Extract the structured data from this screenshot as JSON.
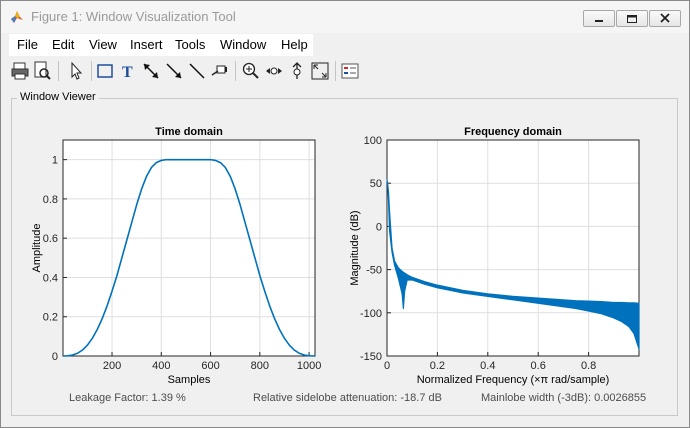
{
  "window": {
    "title": "Figure 1: Window Visualization Tool",
    "controls": [
      "minimize",
      "restore",
      "close"
    ]
  },
  "menu": {
    "items": [
      "File",
      "Edit",
      "View",
      "Insert",
      "Tools",
      "Window",
      "Help"
    ]
  },
  "toolbar": {
    "buttons": [
      {
        "name": "print-icon"
      },
      {
        "name": "print-preview-icon"
      },
      {
        "name": "pointer-icon"
      },
      {
        "name": "rectangle-icon"
      },
      {
        "name": "text-icon"
      },
      {
        "name": "double-arrow-icon"
      },
      {
        "name": "arrow-icon"
      },
      {
        "name": "line-icon"
      },
      {
        "name": "pin-icon"
      },
      {
        "name": "zoom-in-icon"
      },
      {
        "name": "pan-icon"
      },
      {
        "name": "data-cursor-icon"
      },
      {
        "name": "full-view-icon"
      },
      {
        "name": "legend-icon"
      }
    ]
  },
  "panel": {
    "title": "Window Viewer"
  },
  "colors": {
    "line": "#0072bd",
    "grid": "#dfdfdf"
  },
  "chart_data": [
    {
      "type": "line",
      "title": "Time domain",
      "xlabel": "Samples",
      "ylabel": "Amplitude",
      "xlim": [
        1,
        1024
      ],
      "ylim": [
        0,
        1.1
      ],
      "xticks": [
        200,
        400,
        600,
        800,
        1000
      ],
      "yticks": [
        0,
        0.2,
        0.4,
        0.6,
        0.8,
        1
      ],
      "xtick_labels": [
        "200",
        "400",
        "600",
        "800",
        "1000"
      ],
      "ytick_labels": [
        "0",
        "0.2",
        "0.4",
        "0.6",
        "0.8",
        "1"
      ],
      "series": [
        {
          "x": [
            1,
            20,
            40,
            60,
            80,
            100,
            120,
            140,
            160,
            180,
            200,
            220,
            240,
            260,
            280,
            300,
            320,
            340,
            360,
            380,
            400,
            420,
            440,
            460,
            480,
            500,
            520,
            540,
            560,
            580,
            600,
            620,
            640,
            660,
            680,
            700,
            720,
            740,
            760,
            780,
            800,
            820,
            840,
            860,
            880,
            900,
            920,
            940,
            960,
            980,
            1000,
            1024
          ],
          "y": [
            0,
            0.001,
            0.005,
            0.014,
            0.03,
            0.055,
            0.09,
            0.135,
            0.19,
            0.255,
            0.33,
            0.41,
            0.5,
            0.59,
            0.68,
            0.77,
            0.85,
            0.915,
            0.96,
            0.985,
            0.996,
            1.0,
            1.0,
            1.0,
            1.0,
            1.0,
            1.0,
            1.0,
            1.0,
            1.0,
            1.0,
            0.996,
            0.985,
            0.96,
            0.915,
            0.85,
            0.77,
            0.68,
            0.59,
            0.5,
            0.41,
            0.33,
            0.255,
            0.19,
            0.135,
            0.09,
            0.055,
            0.03,
            0.014,
            0.005,
            0.001,
            0
          ]
        }
      ]
    },
    {
      "type": "line",
      "title": "Frequency domain",
      "xlabel": "Normalized Frequency  (×π rad/sample)",
      "ylabel": "Magnitude (dB)",
      "xlim": [
        0,
        1
      ],
      "ylim": [
        -150,
        100
      ],
      "xticks": [
        0,
        0.2,
        0.4,
        0.6,
        0.8
      ],
      "yticks": [
        -150,
        -100,
        -50,
        0,
        50,
        100
      ],
      "xtick_labels": [
        "0",
        "0.2",
        "0.4",
        "0.6",
        "0.8"
      ],
      "ytick_labels": [
        "-150",
        "-100",
        "-50",
        "0",
        "50",
        "100"
      ],
      "envelope_upper": {
        "x": [
          0.0,
          0.003,
          0.006,
          0.01,
          0.02,
          0.03,
          0.045,
          0.06,
          0.08,
          0.1,
          0.15,
          0.2,
          0.25,
          0.3,
          0.35,
          0.4,
          0.45,
          0.5,
          0.55,
          0.6,
          0.65,
          0.7,
          0.75,
          0.8,
          0.85,
          0.9,
          0.93,
          0.96,
          0.98,
          1.0
        ],
        "y": [
          54,
          48,
          40,
          18,
          -25,
          -40,
          -48,
          -52,
          -56,
          -59,
          -64,
          -68,
          -71,
          -74,
          -76,
          -78,
          -79.5,
          -81,
          -82,
          -83,
          -84,
          -85,
          -86,
          -86.5,
          -87,
          -88,
          -88,
          -88.5,
          -88.5,
          -89
        ]
      },
      "envelope_lower": {
        "x": [
          0.0,
          0.003,
          0.006,
          0.01,
          0.02,
          0.03,
          0.045,
          0.06,
          0.065,
          0.07,
          0.08,
          0.1,
          0.15,
          0.2,
          0.25,
          0.3,
          0.35,
          0.4,
          0.45,
          0.5,
          0.55,
          0.6,
          0.65,
          0.7,
          0.75,
          0.8,
          0.85,
          0.9,
          0.93,
          0.96,
          0.98,
          1.0
        ],
        "y": [
          54,
          48,
          30,
          -5,
          -30,
          -45,
          -60,
          -78,
          -95,
          -75,
          -62,
          -62,
          -67,
          -71,
          -74,
          -77,
          -79,
          -81,
          -83,
          -85,
          -87,
          -89,
          -91,
          -93,
          -95,
          -98,
          -101,
          -106,
          -110,
          -116,
          -124,
          -142
        ]
      }
    }
  ],
  "status": {
    "leakage": "Leakage Factor: 1.39 %",
    "sidelobe": "Relative sidelobe attenuation: -18.7 dB",
    "mainlobe": "Mainlobe width (-3dB): 0.0026855"
  }
}
